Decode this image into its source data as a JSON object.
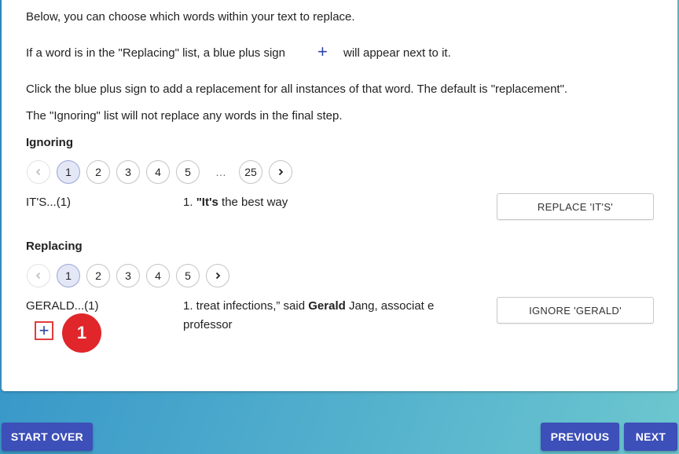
{
  "instructions": {
    "line1": "Below, you can choose which words within your text to replace.",
    "line2_before": "If a word is in the \"Replacing\" list, a blue plus sign",
    "line2_icon": "+",
    "line2_after": "will appear next to it.",
    "line3": "Click the blue plus sign to add a replacement for all instances of that word. The default is \"replacement\".",
    "line4": "The \"Ignoring\" list will not replace any words in the final step."
  },
  "ignoring": {
    "heading": "Ignoring",
    "pages": [
      "1",
      "2",
      "3",
      "4",
      "5",
      "…",
      "25"
    ],
    "selected_page": "1",
    "word": "IT'S...(1)",
    "context_prefix": "1. ",
    "context_bold": "\"It's",
    "context_rest": " the best way",
    "button_label": "REPLACE 'IT'S'"
  },
  "replacing": {
    "heading": "Replacing",
    "pages": [
      "1",
      "2",
      "3",
      "4",
      "5"
    ],
    "selected_page": "1",
    "word": "GERALD...(1)",
    "context_prefix": "1. treat infections,” said ",
    "context_bold": "Gerald",
    "context_rest": " Jang, associat e professor",
    "button_label": "IGNORE 'GERALD'",
    "add_icon": "+",
    "annotation_badge": "1"
  },
  "footer": {
    "start_over": "START OVER",
    "previous": "PREVIOUS",
    "next": "NEXT"
  },
  "colors": {
    "accent": "#3d4fb8",
    "plus": "#2a45a8",
    "badge": "#e0262a"
  }
}
